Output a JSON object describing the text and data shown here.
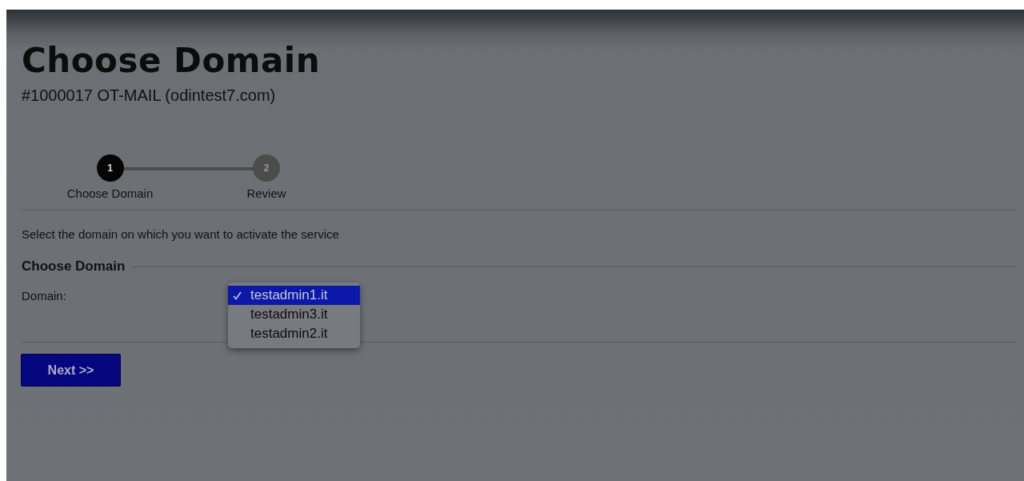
{
  "page": {
    "title": "Choose Domain",
    "subtitle": "#1000017 OT-MAIL (odintest7.com)"
  },
  "steps": [
    {
      "number": "1",
      "label": "Choose Domain",
      "current": true
    },
    {
      "number": "2",
      "label": "Review",
      "current": false
    }
  ],
  "instruction": "Select the domain on which you want to activate the service",
  "section": {
    "legend": "Choose Domain",
    "field_label": "Domain:",
    "options": [
      {
        "label": "testadmin1.it",
        "selected": true
      },
      {
        "label": "testadmin3.it",
        "selected": false
      },
      {
        "label": "testadmin2.it",
        "selected": false
      }
    ]
  },
  "buttons": [
    {
      "label": "Next >>"
    }
  ]
}
